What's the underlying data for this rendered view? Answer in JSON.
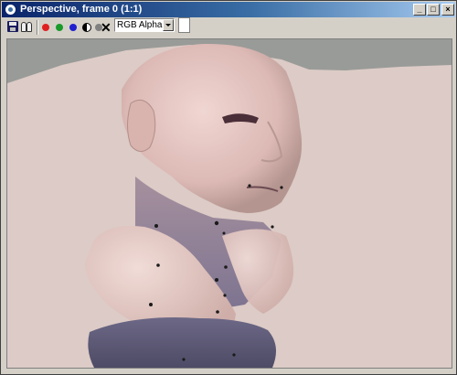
{
  "window": {
    "title": "Perspective, frame 0 (1:1)",
    "controls": {
      "minimize": "_",
      "maximize": "□",
      "close": "×"
    }
  },
  "toolbar": {
    "channel_select": {
      "value": "RGB Alpha"
    },
    "icons": [
      "save-icon",
      "clone-icon",
      "red-channel-icon",
      "green-channel-icon",
      "blue-channel-icon",
      "mono-icon",
      "alpha-icon",
      "clear-icon"
    ],
    "channel_colors": {
      "red": "#e02020",
      "green": "#1a9a2a",
      "blue": "#2020d0",
      "alpha": "#808080"
    }
  },
  "render": {
    "description_colors": {
      "background": "#dccbc6",
      "wall": "#999b98",
      "skin": "#e3c4c0",
      "shadow": "#6c6886"
    }
  }
}
